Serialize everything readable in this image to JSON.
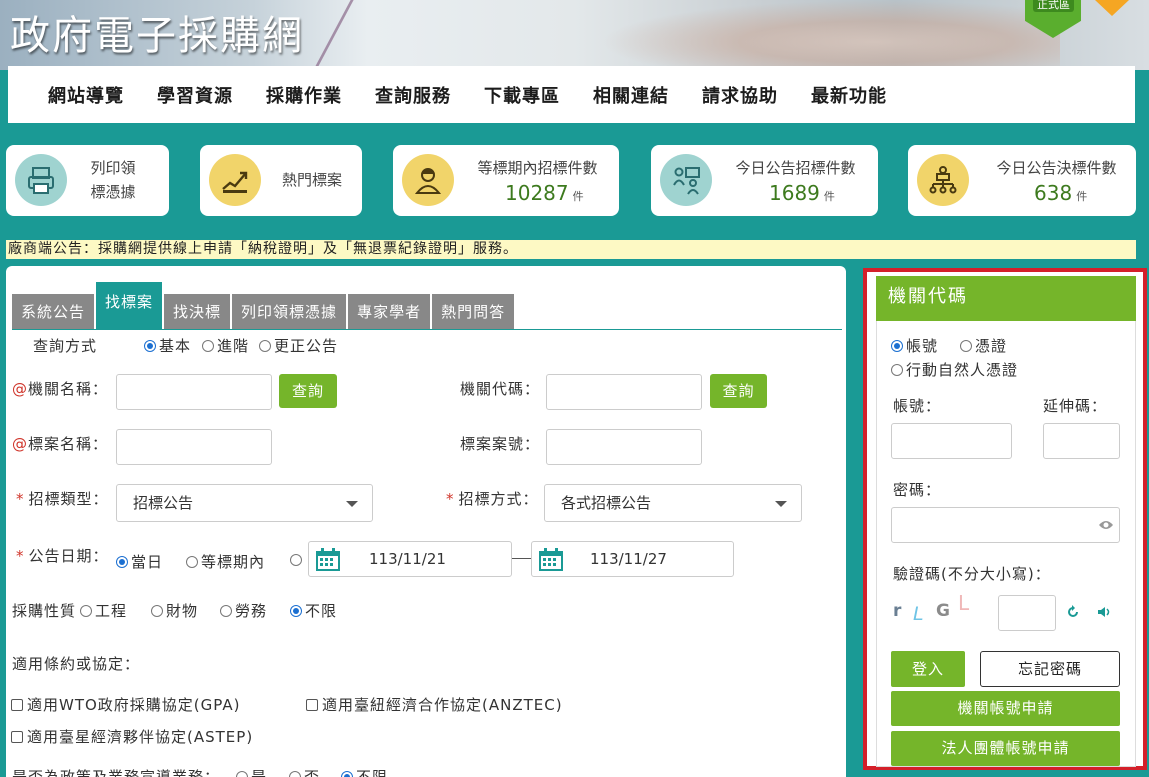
{
  "header": {
    "site_title": "政府電子採購網",
    "badge_text": "正式區"
  },
  "nav": {
    "items": [
      "網站導覽",
      "學習資源",
      "採購作業",
      "查詢服務",
      "下載專區",
      "相關連結",
      "請求協助",
      "最新功能"
    ]
  },
  "cards": [
    {
      "line1": "列印領",
      "line2": "標憑據",
      "icon": "print-icon"
    },
    {
      "label": "熱門標案",
      "icon": "trend-icon"
    },
    {
      "label": "等標期內招標件數",
      "count": "10287",
      "unit": "件",
      "icon": "worker-icon"
    },
    {
      "label": "今日公告招標件數",
      "count": "1689",
      "unit": "件",
      "icon": "meeting-icon"
    },
    {
      "label": "今日公告決標件數",
      "count": "638",
      "unit": "件",
      "icon": "org-chart-icon"
    }
  ],
  "notice": "廠商端公告：採購網提供線上申請「納稅證明」及「無退票紀錄證明」服務。",
  "tabs": [
    "系統公告",
    "找標案",
    "找決標",
    "列印領標憑據",
    "專家學者",
    "熱門問答"
  ],
  "form": {
    "query_mode_label": "查詢方式",
    "query_modes": [
      "基本",
      "進階",
      "更正公告"
    ],
    "agency_name_label": "機關名稱：",
    "agency_code_label": "機關代碼：",
    "query_button": "查詢",
    "tender_name_label": "標案名稱：",
    "tender_no_label": "標案案號：",
    "tender_type_label": "招標類型：",
    "tender_type_value": "招標公告",
    "tender_method_label": "招標方式：",
    "tender_method_value": "各式招標公告",
    "pub_date_label": "公告日期：",
    "pub_date_opts": [
      "當日",
      "等標期內"
    ],
    "date_from": "113/11/21",
    "date_to": "113/11/27",
    "nature_label": "採購性質",
    "nature_opts": [
      "工程",
      "財物",
      "勞務",
      "不限"
    ],
    "treaty_label": "適用條約或協定：",
    "treaties": [
      "適用WTO政府採購協定(GPA)",
      "適用臺紐經濟合作協定(ANZTEC)",
      "適用臺星經濟夥伴協定(ASTEP)"
    ],
    "policy_label": "是否為政策及業務宣導業務：",
    "policy_opts": [
      "是",
      "否",
      "不限"
    ]
  },
  "login": {
    "title": "機關代碼",
    "modes": [
      "帳號",
      "憑證",
      "行動自然人憑證"
    ],
    "account_label": "帳號：",
    "ext_label": "延伸碼：",
    "password_label": "密碼：",
    "captcha_label": "驗證碼(不分大小寫)：",
    "captcha_chars": [
      "r",
      "L",
      "G",
      "L"
    ],
    "login_button": "登入",
    "forgot_button": "忘記密碼",
    "apply_agency_button": "機關帳號申請",
    "apply_corp_button": "法人團體帳號申請"
  }
}
